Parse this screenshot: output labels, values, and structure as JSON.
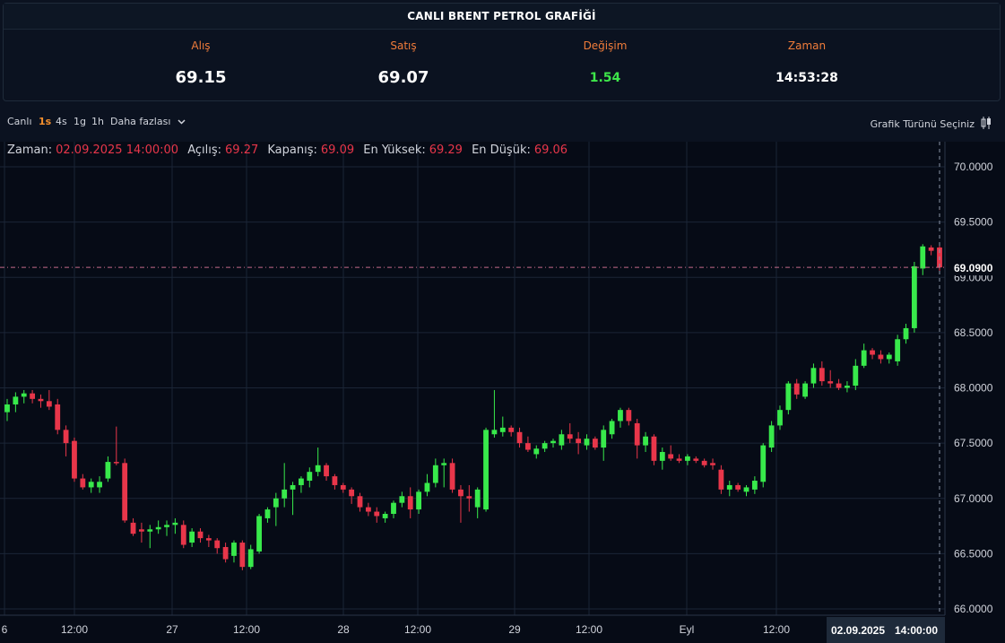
{
  "header": {
    "title": "CANLI BRENT PETROL GRAFİĞİ"
  },
  "stats": [
    {
      "label": "Alış",
      "value": "69.15"
    },
    {
      "label": "Satış",
      "value": "69.07"
    },
    {
      "label": "Değişim",
      "value": "1.54"
    },
    {
      "label": "Zaman",
      "value": "14:53:28"
    }
  ],
  "toolbar": {
    "intervals": [
      "Canlı",
      "1s",
      "4s",
      "1g",
      "1h"
    ],
    "active_interval": "1s",
    "more_label": "Daha fazlası",
    "chart_type_label": "Grafik Türünü Seçiniz"
  },
  "legend": {
    "time_key": "Zaman:",
    "time_val": "02.09.2025 14:00:00",
    "open_key": "Açılış:",
    "open_val": "69.27",
    "close_key": "Kapanış:",
    "close_val": "69.09",
    "high_key": "En Yüksek:",
    "high_val": "69.29",
    "low_key": "En Düşük:",
    "low_val": "69.06"
  },
  "colors": {
    "up": "#38e94b",
    "down": "#e8364a",
    "grid": "#1b2536",
    "background": "#0b1220",
    "accent": "#f07c3a"
  },
  "chart_data": {
    "type": "candlestick",
    "y_ticks": [
      "70.0000",
      "69.5000",
      "69.0000",
      "68.5000",
      "68.0000",
      "67.5000",
      "67.0000",
      "66.5000",
      "66.0000"
    ],
    "ylim": [
      65.95,
      70.1
    ],
    "x_ticks": [
      "6",
      "12:00",
      "27",
      "12:00",
      "28",
      "12:00",
      "29",
      "12:00",
      "Eyl",
      "12:00",
      "14:00:00"
    ],
    "crosshair_time_label": "02.09.2025",
    "crosshair_time_value": "14:00:00",
    "last_price_label": "69.0900",
    "last_price": 69.09,
    "candles": [
      {
        "o": 67.78,
        "h": 67.9,
        "l": 67.7,
        "c": 67.85
      },
      {
        "o": 67.85,
        "h": 67.96,
        "l": 67.78,
        "c": 67.92
      },
      {
        "o": 67.92,
        "h": 67.98,
        "l": 67.86,
        "c": 67.95
      },
      {
        "o": 67.95,
        "h": 67.98,
        "l": 67.86,
        "c": 67.9
      },
      {
        "o": 67.9,
        "h": 67.94,
        "l": 67.82,
        "c": 67.88
      },
      {
        "o": 67.88,
        "h": 67.98,
        "l": 67.8,
        "c": 67.83
      },
      {
        "o": 67.85,
        "h": 67.9,
        "l": 67.58,
        "c": 67.62
      },
      {
        "o": 67.62,
        "h": 67.66,
        "l": 67.38,
        "c": 67.5
      },
      {
        "o": 67.52,
        "h": 67.55,
        "l": 67.15,
        "c": 67.18
      },
      {
        "o": 67.18,
        "h": 67.22,
        "l": 67.08,
        "c": 67.1
      },
      {
        "o": 67.1,
        "h": 67.18,
        "l": 67.05,
        "c": 67.15
      },
      {
        "o": 67.1,
        "h": 67.2,
        "l": 67.05,
        "c": 67.15
      },
      {
        "o": 67.18,
        "h": 67.38,
        "l": 67.15,
        "c": 67.33
      },
      {
        "o": 67.33,
        "h": 67.65,
        "l": 67.3,
        "c": 67.32
      },
      {
        "o": 67.32,
        "h": 67.36,
        "l": 66.78,
        "c": 66.8
      },
      {
        "o": 66.78,
        "h": 66.82,
        "l": 66.66,
        "c": 66.68
      },
      {
        "o": 66.72,
        "h": 66.78,
        "l": 66.6,
        "c": 66.7
      },
      {
        "o": 66.7,
        "h": 66.76,
        "l": 66.55,
        "c": 66.72
      },
      {
        "o": 66.72,
        "h": 66.8,
        "l": 66.68,
        "c": 66.74
      },
      {
        "o": 66.74,
        "h": 66.8,
        "l": 66.66,
        "c": 66.76
      },
      {
        "o": 66.76,
        "h": 66.82,
        "l": 66.68,
        "c": 66.78
      },
      {
        "o": 66.76,
        "h": 66.8,
        "l": 66.55,
        "c": 66.58
      },
      {
        "o": 66.6,
        "h": 66.73,
        "l": 66.56,
        "c": 66.7
      },
      {
        "o": 66.7,
        "h": 66.73,
        "l": 66.6,
        "c": 66.64
      },
      {
        "o": 66.64,
        "h": 66.67,
        "l": 66.56,
        "c": 66.62
      },
      {
        "o": 66.62,
        "h": 66.64,
        "l": 66.5,
        "c": 66.55
      },
      {
        "o": 66.56,
        "h": 66.6,
        "l": 66.42,
        "c": 66.45
      },
      {
        "o": 66.48,
        "h": 66.62,
        "l": 66.42,
        "c": 66.6
      },
      {
        "o": 66.6,
        "h": 66.62,
        "l": 66.35,
        "c": 66.38
      },
      {
        "o": 66.38,
        "h": 66.58,
        "l": 66.36,
        "c": 66.54
      },
      {
        "o": 66.52,
        "h": 66.86,
        "l": 66.5,
        "c": 66.84
      },
      {
        "o": 66.82,
        "h": 66.92,
        "l": 66.78,
        "c": 66.9
      },
      {
        "o": 66.92,
        "h": 67.05,
        "l": 66.75,
        "c": 67.0
      },
      {
        "o": 67.0,
        "h": 67.32,
        "l": 66.92,
        "c": 67.08
      },
      {
        "o": 67.08,
        "h": 67.15,
        "l": 66.85,
        "c": 67.12
      },
      {
        "o": 67.12,
        "h": 67.2,
        "l": 67.05,
        "c": 67.18
      },
      {
        "o": 67.16,
        "h": 67.28,
        "l": 67.1,
        "c": 67.24
      },
      {
        "o": 67.24,
        "h": 67.46,
        "l": 67.2,
        "c": 67.3
      },
      {
        "o": 67.3,
        "h": 67.32,
        "l": 67.16,
        "c": 67.2
      },
      {
        "o": 67.2,
        "h": 67.22,
        "l": 67.08,
        "c": 67.12
      },
      {
        "o": 67.12,
        "h": 67.14,
        "l": 67.05,
        "c": 67.08
      },
      {
        "o": 67.08,
        "h": 67.1,
        "l": 66.95,
        "c": 67.02
      },
      {
        "o": 67.02,
        "h": 67.05,
        "l": 66.88,
        "c": 66.92
      },
      {
        "o": 66.92,
        "h": 66.96,
        "l": 66.84,
        "c": 66.88
      },
      {
        "o": 66.88,
        "h": 66.92,
        "l": 66.78,
        "c": 66.84
      },
      {
        "o": 66.82,
        "h": 66.88,
        "l": 66.78,
        "c": 66.86
      },
      {
        "o": 66.86,
        "h": 66.98,
        "l": 66.82,
        "c": 66.96
      },
      {
        "o": 66.96,
        "h": 67.06,
        "l": 66.92,
        "c": 67.02
      },
      {
        "o": 67.02,
        "h": 67.1,
        "l": 66.82,
        "c": 66.9
      },
      {
        "o": 66.9,
        "h": 67.08,
        "l": 66.86,
        "c": 67.06
      },
      {
        "o": 67.06,
        "h": 67.22,
        "l": 67.02,
        "c": 67.14
      },
      {
        "o": 67.14,
        "h": 67.36,
        "l": 67.1,
        "c": 67.3
      },
      {
        "o": 67.3,
        "h": 67.36,
        "l": 67.1,
        "c": 67.32
      },
      {
        "o": 67.32,
        "h": 67.36,
        "l": 67.05,
        "c": 67.08
      },
      {
        "o": 67.08,
        "h": 67.12,
        "l": 66.78,
        "c": 67.02
      },
      {
        "o": 67.02,
        "h": 67.12,
        "l": 66.88,
        "c": 67.0
      },
      {
        "o": 66.92,
        "h": 67.1,
        "l": 66.82,
        "c": 67.08
      },
      {
        "o": 66.9,
        "h": 67.64,
        "l": 66.88,
        "c": 67.62
      },
      {
        "o": 67.58,
        "h": 67.98,
        "l": 67.55,
        "c": 67.62
      },
      {
        "o": 67.6,
        "h": 67.74,
        "l": 67.56,
        "c": 67.64
      },
      {
        "o": 67.64,
        "h": 67.66,
        "l": 67.56,
        "c": 67.6
      },
      {
        "o": 67.6,
        "h": 67.64,
        "l": 67.46,
        "c": 67.5
      },
      {
        "o": 67.5,
        "h": 67.56,
        "l": 67.42,
        "c": 67.44
      },
      {
        "o": 67.4,
        "h": 67.48,
        "l": 67.36,
        "c": 67.45
      },
      {
        "o": 67.45,
        "h": 67.52,
        "l": 67.42,
        "c": 67.5
      },
      {
        "o": 67.5,
        "h": 67.54,
        "l": 67.46,
        "c": 67.52
      },
      {
        "o": 67.48,
        "h": 67.62,
        "l": 67.44,
        "c": 67.58
      },
      {
        "o": 67.58,
        "h": 67.68,
        "l": 67.5,
        "c": 67.54
      },
      {
        "o": 67.54,
        "h": 67.6,
        "l": 67.4,
        "c": 67.5
      },
      {
        "o": 67.48,
        "h": 67.58,
        "l": 67.44,
        "c": 67.54
      },
      {
        "o": 67.54,
        "h": 67.56,
        "l": 67.44,
        "c": 67.46
      },
      {
        "o": 67.46,
        "h": 67.66,
        "l": 67.34,
        "c": 67.62
      },
      {
        "o": 67.58,
        "h": 67.72,
        "l": 67.54,
        "c": 67.7
      },
      {
        "o": 67.7,
        "h": 67.82,
        "l": 67.64,
        "c": 67.8
      },
      {
        "o": 67.8,
        "h": 67.82,
        "l": 67.66,
        "c": 67.7
      },
      {
        "o": 67.68,
        "h": 67.72,
        "l": 67.36,
        "c": 67.48
      },
      {
        "o": 67.48,
        "h": 67.6,
        "l": 67.42,
        "c": 67.56
      },
      {
        "o": 67.56,
        "h": 67.58,
        "l": 67.3,
        "c": 67.34
      },
      {
        "o": 67.34,
        "h": 67.46,
        "l": 67.26,
        "c": 67.42
      },
      {
        "o": 67.4,
        "h": 67.48,
        "l": 67.34,
        "c": 67.36
      },
      {
        "o": 67.36,
        "h": 67.4,
        "l": 67.32,
        "c": 67.34
      },
      {
        "o": 67.34,
        "h": 67.4,
        "l": 67.3,
        "c": 67.38
      },
      {
        "o": 67.36,
        "h": 67.38,
        "l": 67.32,
        "c": 67.34
      },
      {
        "o": 67.34,
        "h": 67.36,
        "l": 67.28,
        "c": 67.3
      },
      {
        "o": 67.32,
        "h": 67.36,
        "l": 67.26,
        "c": 67.3
      },
      {
        "o": 67.26,
        "h": 67.3,
        "l": 67.04,
        "c": 67.08
      },
      {
        "o": 67.08,
        "h": 67.16,
        "l": 67.02,
        "c": 67.12
      },
      {
        "o": 67.12,
        "h": 67.14,
        "l": 67.06,
        "c": 67.08
      },
      {
        "o": 67.06,
        "h": 67.12,
        "l": 67.02,
        "c": 67.1
      },
      {
        "o": 67.08,
        "h": 67.2,
        "l": 67.04,
        "c": 67.16
      },
      {
        "o": 67.15,
        "h": 67.5,
        "l": 67.1,
        "c": 67.48
      },
      {
        "o": 67.46,
        "h": 67.7,
        "l": 67.42,
        "c": 67.66
      },
      {
        "o": 67.66,
        "h": 67.84,
        "l": 67.62,
        "c": 67.8
      },
      {
        "o": 67.8,
        "h": 68.06,
        "l": 67.76,
        "c": 68.04
      },
      {
        "o": 68.04,
        "h": 68.08,
        "l": 67.9,
        "c": 67.94
      },
      {
        "o": 67.92,
        "h": 68.06,
        "l": 67.9,
        "c": 68.04
      },
      {
        "o": 68.04,
        "h": 68.22,
        "l": 68.0,
        "c": 68.18
      },
      {
        "o": 68.18,
        "h": 68.24,
        "l": 68.02,
        "c": 68.06
      },
      {
        "o": 68.06,
        "h": 68.16,
        "l": 68.0,
        "c": 68.04
      },
      {
        "o": 68.04,
        "h": 68.08,
        "l": 67.98,
        "c": 68.0
      },
      {
        "o": 68.0,
        "h": 68.06,
        "l": 67.96,
        "c": 68.02
      },
      {
        "o": 68.02,
        "h": 68.26,
        "l": 67.98,
        "c": 68.2
      },
      {
        "o": 68.2,
        "h": 68.4,
        "l": 68.18,
        "c": 68.34
      },
      {
        "o": 68.34,
        "h": 68.36,
        "l": 68.26,
        "c": 68.3
      },
      {
        "o": 68.3,
        "h": 68.34,
        "l": 68.22,
        "c": 68.26
      },
      {
        "o": 68.26,
        "h": 68.32,
        "l": 68.22,
        "c": 68.3
      },
      {
        "o": 68.24,
        "h": 68.48,
        "l": 68.2,
        "c": 68.44
      },
      {
        "o": 68.44,
        "h": 68.58,
        "l": 68.4,
        "c": 68.54
      },
      {
        "o": 68.54,
        "h": 69.14,
        "l": 68.5,
        "c": 69.1
      },
      {
        "o": 69.08,
        "h": 69.3,
        "l": 69.02,
        "c": 69.28
      },
      {
        "o": 69.27,
        "h": 69.29,
        "l": 69.2,
        "c": 69.24
      },
      {
        "o": 69.27,
        "h": 69.29,
        "l": 69.06,
        "c": 69.09
      }
    ]
  }
}
